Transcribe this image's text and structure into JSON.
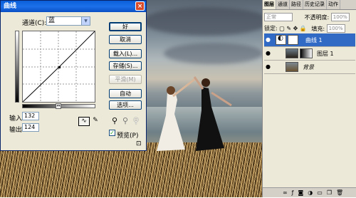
{
  "curves": {
    "title": "曲线",
    "close": "×",
    "channel_label": "通道(C):",
    "channel_value": "蓝",
    "buttons": {
      "ok": "好",
      "cancel": "取消",
      "load": "载入(L)...",
      "save": "存储(S)...",
      "smooth": "平滑(M)",
      "auto": "自动",
      "options": "选项..."
    },
    "input_label": "输入:",
    "input_value": "132",
    "output_label": "输出:",
    "output_value": "124",
    "preview_label": "预览(P)",
    "preview_checked": true,
    "icons": [
      "curve-tool-icon",
      "pencil-icon",
      "black-eyedropper-icon",
      "gray-eyedropper-icon",
      "white-eyedropper-icon",
      "expand-icon"
    ]
  },
  "layers_panel": {
    "tabs": [
      "图层",
      "通道",
      "路径",
      "历史记录",
      "动作"
    ],
    "blend_mode": "正常",
    "opacity_label": "不透明度:",
    "opacity_value": "100%",
    "lock_label": "锁定:",
    "fill_label": "填充:",
    "fill_value": "100%",
    "layers": [
      {
        "name": "曲线 1",
        "selected": true
      },
      {
        "name": "图层 1",
        "selected": false
      },
      {
        "name": "背景",
        "selected": false
      }
    ],
    "accent": "#316ac5"
  }
}
